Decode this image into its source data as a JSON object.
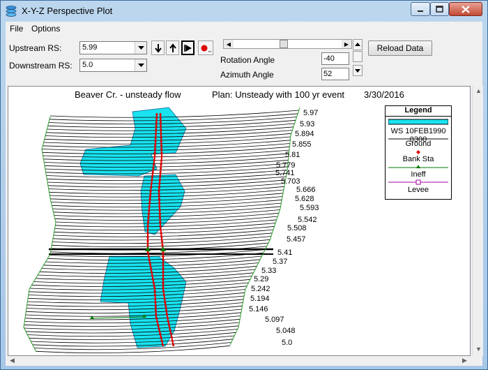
{
  "window": {
    "title": "X-Y-Z Perspective Plot"
  },
  "menu": {
    "items": [
      "File",
      "Options"
    ]
  },
  "controls": {
    "upstream_label": "Upstream RS:",
    "upstream_value": "5.99",
    "downstream_label": "Downstream RS:",
    "downstream_value": "5.0",
    "rotation_label": "Rotation Angle",
    "rotation_value": "-40",
    "azimuth_label": "Azimuth Angle",
    "azimuth_value": "52",
    "reload_label": "Reload Data"
  },
  "plot": {
    "title_river": "Beaver Cr. - unsteady flow",
    "title_plan": "Plan: Unsteady with 100 yr event",
    "title_date": "3/30/2016",
    "stations": [
      "5.97",
      "5.93",
      "5.894",
      "5.855",
      "5.81",
      "5.779",
      "5.741",
      "5.703",
      "5.666",
      "5.628",
      "5.593",
      "5.542",
      "5.508",
      "5.457",
      "5.41",
      "5.37",
      "5.33",
      "5.29",
      "5.242",
      "5.194",
      "5.146",
      "5.097",
      "5.048",
      "5.0"
    ],
    "colors": {
      "water": "#19e3f0",
      "ground": "#000000",
      "bank": "#e00000",
      "ineff": "#007a00",
      "levee": "#a000a0",
      "overbank": "#2e9e2e"
    }
  },
  "legend": {
    "title": "Legend",
    "ws": "WS 10FEB1990 0300",
    "ground": "Ground",
    "bank": "Bank Sta",
    "ineff": "Ineff",
    "levee": "Levee"
  }
}
